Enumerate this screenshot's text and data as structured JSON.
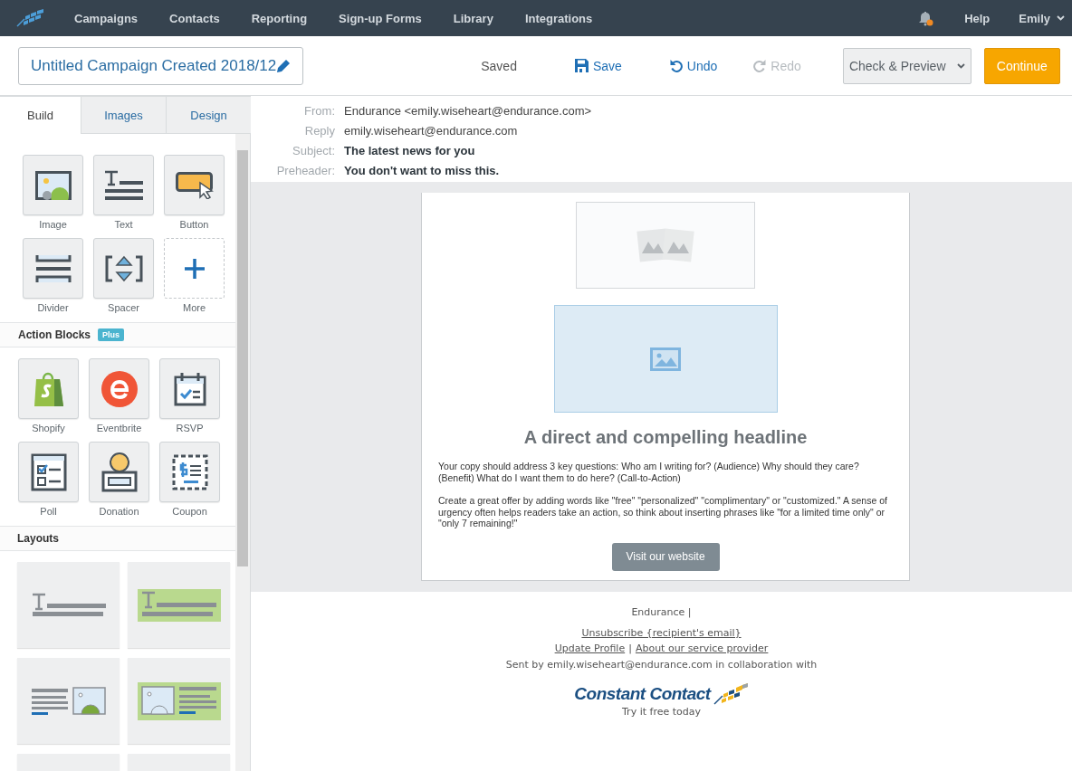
{
  "nav": {
    "items": [
      "Campaigns",
      "Contacts",
      "Reporting",
      "Sign-up Forms",
      "Library",
      "Integrations"
    ],
    "help": "Help",
    "user": "Emily"
  },
  "toolbar": {
    "campaign_name": "Untitled Campaign Created 2018/12",
    "status": "Saved",
    "actions": [
      {
        "kind": "save",
        "label": "Save",
        "disabled": false
      },
      {
        "kind": "undo",
        "label": "Undo",
        "disabled": false
      },
      {
        "kind": "redo",
        "label": "Redo",
        "disabled": true
      }
    ],
    "preview_button": "Check & Preview",
    "continue_button": "Continue"
  },
  "sidebar": {
    "tabs": [
      {
        "label": "Build",
        "selected": true
      },
      {
        "label": "Images",
        "selected": false
      },
      {
        "label": "Design",
        "selected": false
      }
    ],
    "build_blocks": [
      {
        "kind": "image",
        "label": "Image"
      },
      {
        "kind": "text",
        "label": "Text"
      },
      {
        "kind": "button",
        "label": "Button"
      },
      {
        "kind": "divider",
        "label": "Divider"
      },
      {
        "kind": "spacer",
        "label": "Spacer"
      },
      {
        "kind": "more",
        "label": "More"
      }
    ],
    "action_blocks_title": "Action Blocks",
    "plus_badge": "Plus",
    "action_blocks": [
      {
        "kind": "shopify",
        "label": "Shopify"
      },
      {
        "kind": "eventbrite",
        "label": "Eventbrite"
      },
      {
        "kind": "rsvp",
        "label": "RSVP"
      },
      {
        "kind": "poll",
        "label": "Poll"
      },
      {
        "kind": "donation",
        "label": "Donation"
      },
      {
        "kind": "coupon",
        "label": "Coupon"
      }
    ],
    "layouts_title": "Layouts",
    "layouts": [
      {
        "kind": "text"
      },
      {
        "kind": "text-green"
      },
      {
        "kind": "text-image"
      },
      {
        "kind": "image-text-green"
      },
      {
        "kind": "blank"
      },
      {
        "kind": "blank"
      }
    ]
  },
  "email_header": [
    {
      "label": "From:",
      "value": "Endurance <emily.wiseheart@endurance.com>",
      "bold": false
    },
    {
      "label": "Reply",
      "value": "emily.wiseheart@endurance.com",
      "bold": false
    },
    {
      "label": "Subject:",
      "value": "The latest news for you",
      "bold": true
    },
    {
      "label": "Preheader:",
      "value": "You don't want to miss this.",
      "bold": true
    }
  ],
  "email": {
    "headline": "A direct and compelling headline",
    "paragraphs": [
      "Your copy should address 3 key questions: Who am I writing for? (Audience) Why should they care? (Benefit) What do I want them to do here? (Call-to-Action)",
      "Create a great offer by adding words like \"free\" \"personalized\" \"complimentary\" or \"customized.\" A sense of urgency often helps readers take an action, so think about inserting phrases like \"for a limited time only\" or \"only 7 remaining!\""
    ],
    "button": "Visit our website"
  },
  "footer": {
    "company": "Endurance |",
    "unsubscribe": "Unsubscribe {recipient's email}",
    "links": [
      "Update Profile",
      "About our service provider"
    ],
    "separator": "|",
    "sent_by": "Sent by emily.wiseheart@endurance.com in collaboration with",
    "logo_text": "Constant Contact",
    "tagline": "Try it free today"
  }
}
